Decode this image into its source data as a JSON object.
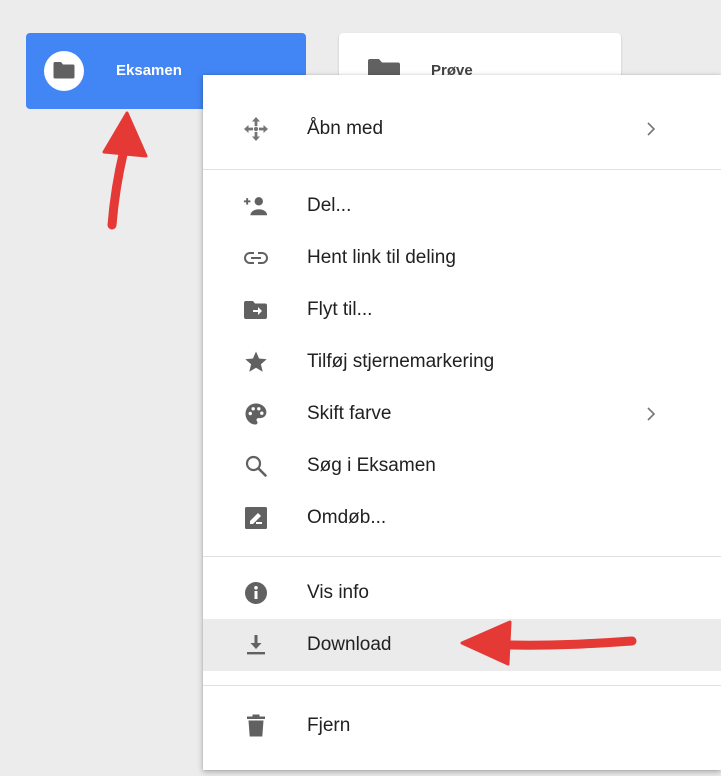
{
  "folders": {
    "selected_name": "Eksamen",
    "other_name": "Prøve"
  },
  "menu": {
    "groups": [
      {
        "items": [
          {
            "label": "Åbn med",
            "icon": "move-cross-icon",
            "submenu": true
          }
        ]
      },
      {
        "items": [
          {
            "label": "Del...",
            "icon": "add-person-icon"
          },
          {
            "label": "Hent link til deling",
            "icon": "link-icon"
          },
          {
            "label": "Flyt til...",
            "icon": "move-to-folder-icon"
          },
          {
            "label": "Tilføj stjernemarkering",
            "icon": "star-icon"
          },
          {
            "label": "Skift farve",
            "icon": "palette-icon",
            "submenu": true
          },
          {
            "label": "Søg i Eksamen",
            "icon": "search-icon"
          },
          {
            "label": "Omdøb...",
            "icon": "rename-icon"
          }
        ]
      },
      {
        "items": [
          {
            "label": "Vis info",
            "icon": "info-icon"
          },
          {
            "label": "Download",
            "icon": "download-icon",
            "highlighted": true
          }
        ]
      },
      {
        "items": [
          {
            "label": "Fjern",
            "icon": "trash-icon"
          }
        ]
      }
    ]
  },
  "colors": {
    "selected_folder": "#4285f4",
    "icon_gray": "#616161",
    "annotation_arrow": "#e53935"
  }
}
